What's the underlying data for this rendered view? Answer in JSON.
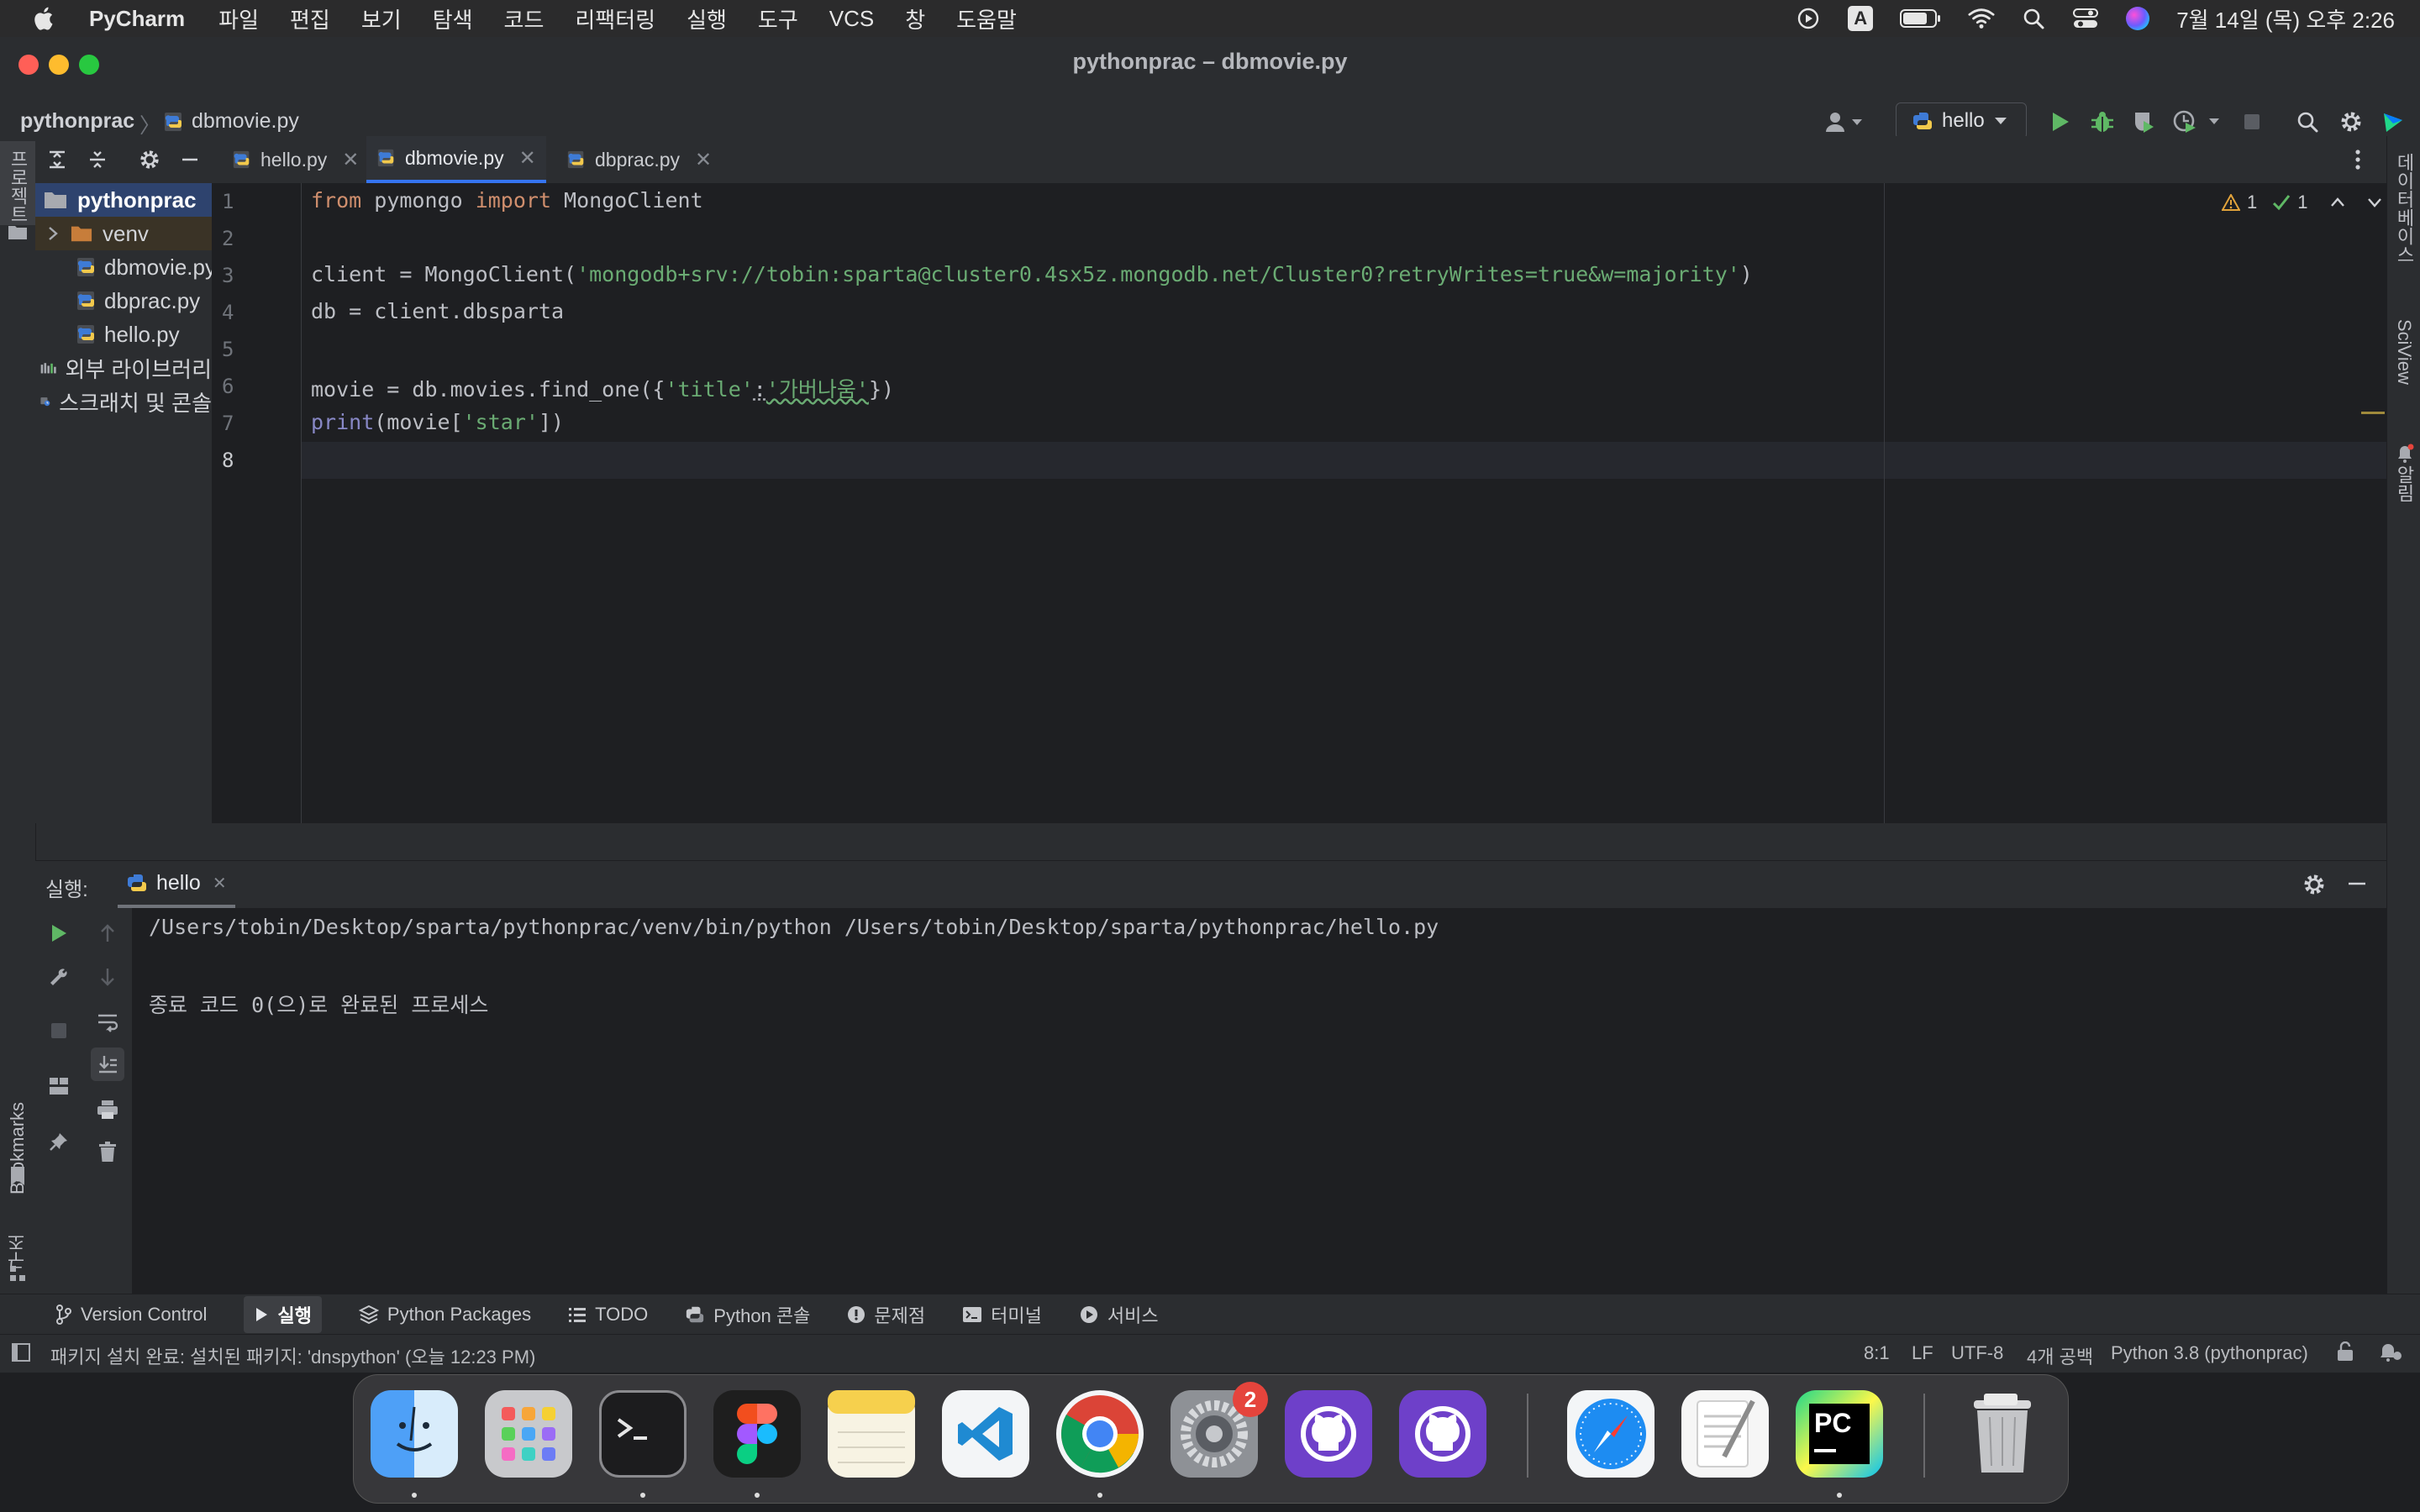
{
  "menubar": {
    "app_name": "PyCharm",
    "items": [
      "파일",
      "편집",
      "보기",
      "탐색",
      "코드",
      "리팩터링",
      "실행",
      "도구",
      "VCS",
      "창",
      "도움말"
    ],
    "input_source": "A",
    "clock": "7월 14일 (목) 오후 2:26"
  },
  "window": {
    "title": "pythonprac – dbmovie.py",
    "breadcrumb": {
      "project": "pythonprac",
      "file": "dbmovie.py"
    },
    "run_config": "hello"
  },
  "left_strip": {
    "project_label": "프로젝트",
    "bookmarks_label": "Bookmarks",
    "structure_label": "구조"
  },
  "right_strip": {
    "database_label": "데이터베이스",
    "sciview_label": "SciView",
    "notifications_label": "알림"
  },
  "project_tree": {
    "root": "pythonprac",
    "items": [
      "venv",
      "dbmovie.py",
      "dbprac.py",
      "hello.py"
    ],
    "external_libraries": "외부 라이브러리",
    "scratches": "스크래치 및 콘솔"
  },
  "tabs": [
    {
      "label": "hello.py"
    },
    {
      "label": "dbmovie.py"
    },
    {
      "label": "dbprac.py"
    }
  ],
  "editor": {
    "inspection": {
      "warnings": "1",
      "ok": "1"
    },
    "line_numbers": [
      "1",
      "2",
      "3",
      "4",
      "5",
      "6",
      "7",
      "8"
    ],
    "lines": [
      {
        "t1": "from",
        "t2": " pymongo ",
        "t3": "import",
        "t4": " MongoClient"
      },
      {
        "t1": "client = MongoClient(",
        "t2": "'mongodb+srv://tobin:sparta@cluster0.4sx5z.mongodb.net/Cluster0?retryWrites=true&w=majority'",
        "t3": ")"
      },
      {
        "t1": "db = client.dbsparta"
      },
      {
        "t1": "movie = db.movies.find_one({",
        "t2": "'title'",
        "t3": ":",
        "t4": "'가버나움'",
        "t5": "})"
      },
      {
        "t1": "print",
        "t2": "(movie[",
        "t3": "'star'",
        "t4": "])"
      }
    ]
  },
  "run_panel": {
    "label": "실행:",
    "tab": "hello",
    "output": [
      "/Users/tobin/Desktop/sparta/pythonprac/venv/bin/python /Users/tobin/Desktop/sparta/pythonprac/hello.py",
      "종료 코드 0(으)로 완료된 프로세스"
    ]
  },
  "bottom_tabs": [
    "Version Control",
    "실행",
    "Python Packages",
    "TODO",
    "Python 콘솔",
    "문제점",
    "터미널",
    "서비스"
  ],
  "status_bar": {
    "message": "패키지 설치 완료: 설치된 패키지: 'dnspython' (오늘 12:23 PM)",
    "position": "8:1",
    "line_separator": "LF",
    "encoding": "UTF-8",
    "indent": "4개 공백",
    "interpreter": "Python 3.8 (pythonprac)"
  },
  "dock": {
    "items": [
      "finder-icon",
      "launchpad-icon",
      "terminal-icon",
      "figma-icon",
      "notes-icon",
      "vscode-icon",
      "chrome-icon",
      "system-settings-icon",
      "github-desktop-icon",
      "github-desktop-icon",
      "safari-icon",
      "textedit-icon",
      "pycharm-icon",
      "trash-icon"
    ],
    "system_settings_badge": "2",
    "pycharm_label": "PC"
  },
  "colors": {
    "accent": "#3574f0",
    "keyword": "#cf8e6d",
    "string": "#6aab73",
    "builtin": "#8888c6",
    "run_green": "#5fb865",
    "badge_red": "#e5443c"
  }
}
